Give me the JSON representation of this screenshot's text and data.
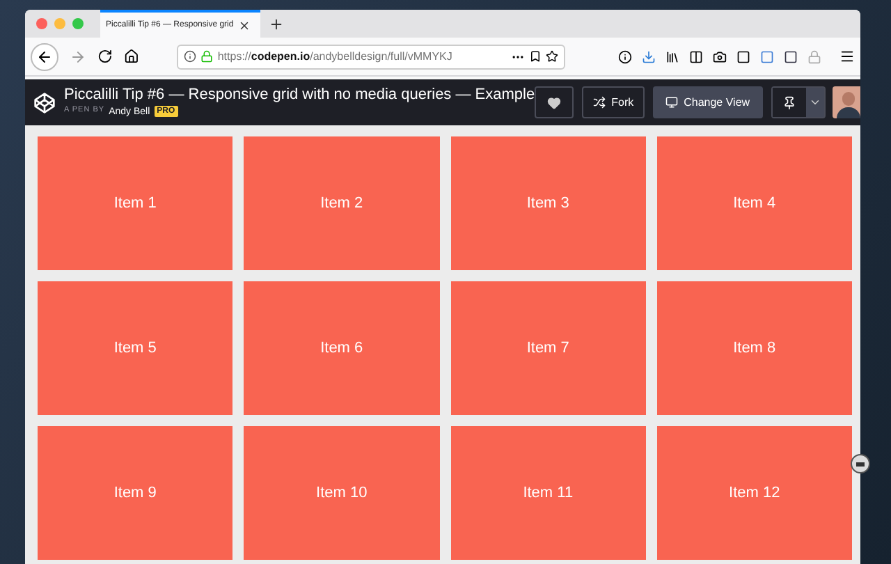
{
  "browser": {
    "tab_title": "Piccalilli Tip #6 — Responsive grid",
    "url_scheme": "https://",
    "url_domain": "codepen.io",
    "url_path": "/andybelldesign/full/vMMYKJ"
  },
  "header": {
    "title": "Piccalilli Tip #6 — Responsive grid with no media queries — Example",
    "byline": "A PEN BY",
    "author": "Andy Bell",
    "badge": "PRO"
  },
  "buttons": {
    "fork": "Fork",
    "change_view": "Change View"
  },
  "items": [
    "Item 1",
    "Item 2",
    "Item 3",
    "Item 4",
    "Item 5",
    "Item 6",
    "Item 7",
    "Item 8",
    "Item 9",
    "Item 10",
    "Item 11",
    "Item 12"
  ]
}
